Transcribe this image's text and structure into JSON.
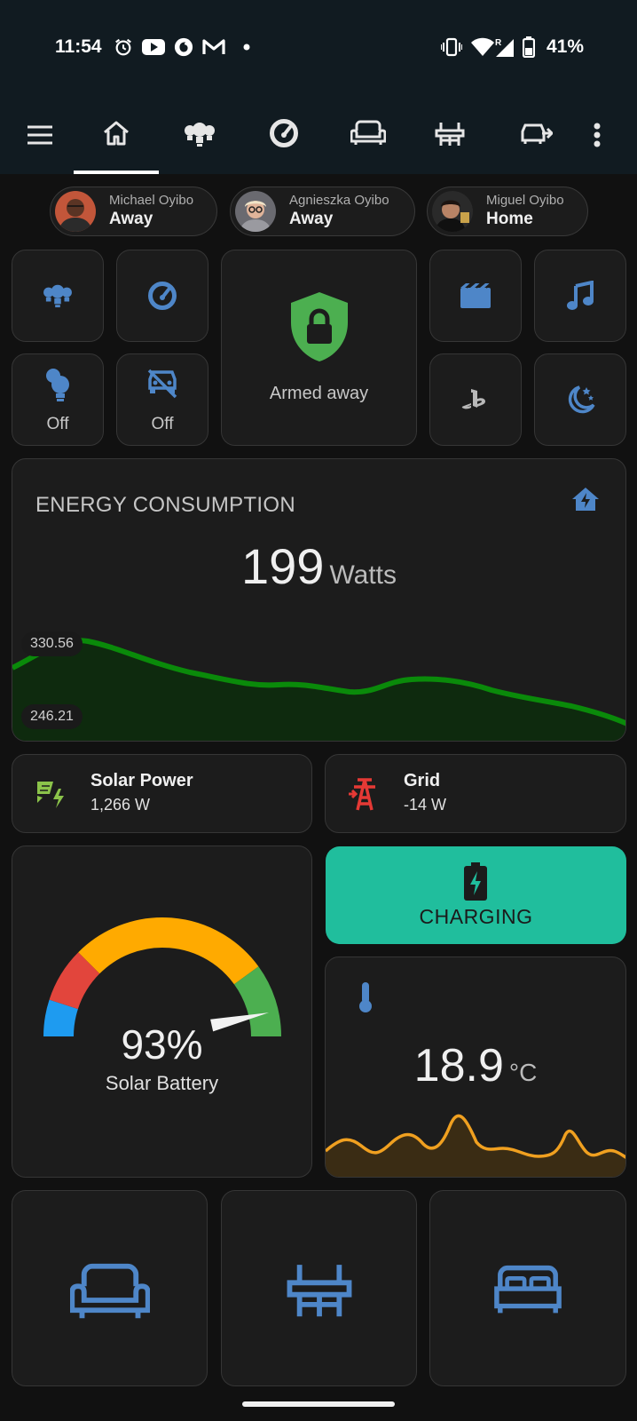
{
  "status_bar": {
    "time": "11:54",
    "battery": "41%",
    "left_icons": [
      "alarm-icon",
      "youtube-icon",
      "vodafone-icon",
      "gmail-icon",
      "dot-icon"
    ],
    "right_icons": [
      "vibrate-icon",
      "wifi-icon",
      "signal-roaming-icon",
      "battery-icon"
    ]
  },
  "app_bar": {
    "tabs": [
      "menu-icon",
      "home-icon",
      "lights-icon",
      "gauge-icon",
      "sofa-icon",
      "table-chairs-icon",
      "car-arrow-icon",
      "more-vert-icon"
    ],
    "selected_tab": "home-icon"
  },
  "people": [
    {
      "name": "Michael Oyibo",
      "state": "Away"
    },
    {
      "name": "Agnieszka Oyibo",
      "state": "Away"
    },
    {
      "name": "Miguel Oyibo",
      "state": "Home"
    }
  ],
  "quick_tiles": {
    "lights_group": {
      "icon": "lights-group-icon"
    },
    "gauge": {
      "icon": "gauge-icon"
    },
    "lamp": {
      "icon": "lightbulb-group-icon",
      "state": "Off"
    },
    "car_charger": {
      "icon": "car-off-icon",
      "state": "Off"
    },
    "alarm": {
      "icon": "shield-lock-icon",
      "state": "Armed away"
    },
    "movie": {
      "icon": "movie-icon"
    },
    "music": {
      "icon": "music-icon"
    },
    "playstation": {
      "icon": "playstation-icon"
    },
    "night": {
      "icon": "night-icon"
    }
  },
  "energy": {
    "title": "ENERGY CONSUMPTION",
    "value": "199",
    "unit": "Watts",
    "max_label": "330.56",
    "min_label": "246.21",
    "icon": "home-lightning-icon",
    "accent": "#0a8a0a"
  },
  "solar": {
    "title": "Solar Power",
    "value": "1,266 W",
    "icon": "solar-power-icon",
    "color": "#8bc34a"
  },
  "grid": {
    "title": "Grid",
    "value": "-14 W",
    "icon": "transmission-tower-icon",
    "color": "#e53935"
  },
  "battery_gauge": {
    "value": "93%",
    "percent": 93,
    "label": "Solar Battery",
    "colors": [
      "#1e9bf0",
      "#e2453c",
      "#ffaa00",
      "#4caf50"
    ]
  },
  "charging": {
    "label": "CHARGING",
    "icon": "battery-charging-icon",
    "color": "#20be9d"
  },
  "temperature": {
    "value": "18.9",
    "unit": "°C",
    "icon": "thermometer-icon",
    "color": "#f0a020"
  },
  "rooms": [
    {
      "icon": "sofa-icon"
    },
    {
      "icon": "table-chairs-icon"
    },
    {
      "icon": "bed-icon"
    }
  ]
}
